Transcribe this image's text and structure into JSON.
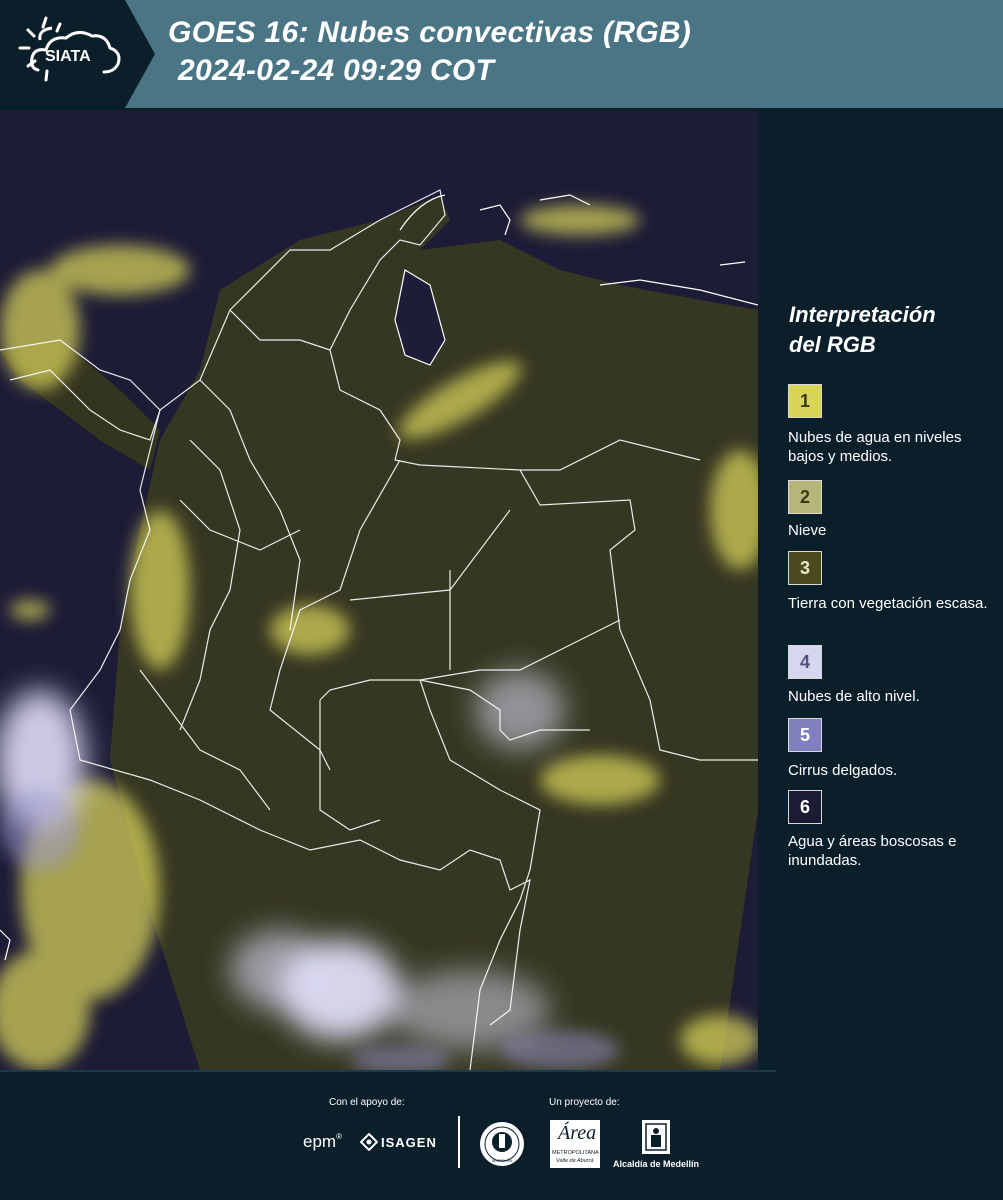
{
  "header": {
    "logo_text": "SIATA",
    "title_line1": "GOES 16: Nubes convectivas (RGB)",
    "title_line2": "2024-02-24 09:29 COT"
  },
  "legend": {
    "title_line1": "Interpretación",
    "title_line2": "del RGB",
    "items": [
      {
        "number": "1",
        "label": "Nubes de agua en niveles bajos y medios.",
        "color": "#d9d45a",
        "text_color": "#3a3a10"
      },
      {
        "number": "2",
        "label": "Nieve",
        "color": "#b8b57a",
        "text_color": "#3a3a10"
      },
      {
        "number": "3",
        "label": "Tierra con vegetación escasa.",
        "color": "#4a4a1c",
        "text_color": "#e6e6c8"
      },
      {
        "number": "4",
        "label": "Nubes de alto nivel.",
        "color": "#d6d6f0",
        "text_color": "#50507a"
      },
      {
        "number": "5",
        "label": "Cirrus delgados.",
        "color": "#8080bf",
        "text_color": "#ffffff"
      },
      {
        "number": "6",
        "label": "Agua y áreas boscosas e inundadas.",
        "color": "#1b1b33",
        "text_color": "#ffffff"
      }
    ]
  },
  "footer": {
    "support_caption": "Con el apoyo de:",
    "project_caption": "Un proyecto de:",
    "epm": "epm",
    "isagen": "ISAGEN",
    "area_text": "Área",
    "area_sub1": "METROPOLITANA",
    "area_sub2": "Valle de Aburrá",
    "alcaldia": "Alcaldía de Medellín",
    "seal_text": "MEDELLÍN"
  },
  "colors": {
    "header_bg": "#4a7585",
    "panel_bg": "#0b1f2b",
    "map_bg": "#1c1b34",
    "cloud_yellow": "#d6d25e",
    "cloud_lavender": "#d8d8f4",
    "border_white": "#ffffff"
  }
}
